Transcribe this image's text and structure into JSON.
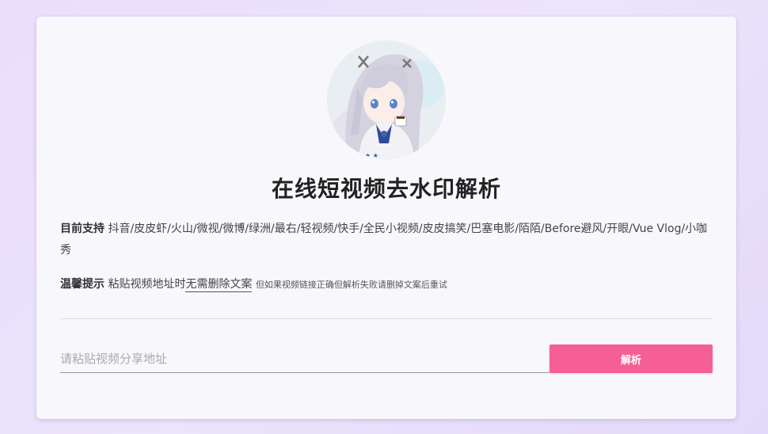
{
  "page": {
    "title": "在线短视频去水印解析"
  },
  "support": {
    "label": "目前支持",
    "platforms": "抖音/皮皮虾/火山/微视/微博/绿洲/最右/轻视频/快手/全民小视频/皮皮搞笑/巴塞电影/陌陌/Before避风/开眼/Vue Vlog/小咖秀"
  },
  "tip": {
    "label": "温馨提示",
    "text_before": "粘贴视频地址时",
    "underlined": "无需删除文案",
    "small_note": "但如果视频链接正确但解析失败请删掉文案后重试"
  },
  "form": {
    "placeholder": "请粘贴视频分享地址",
    "value": "",
    "button_label": "解析"
  },
  "colors": {
    "accent": "#f65f94",
    "background": "#e9defc",
    "card": "#f8f7fb"
  }
}
